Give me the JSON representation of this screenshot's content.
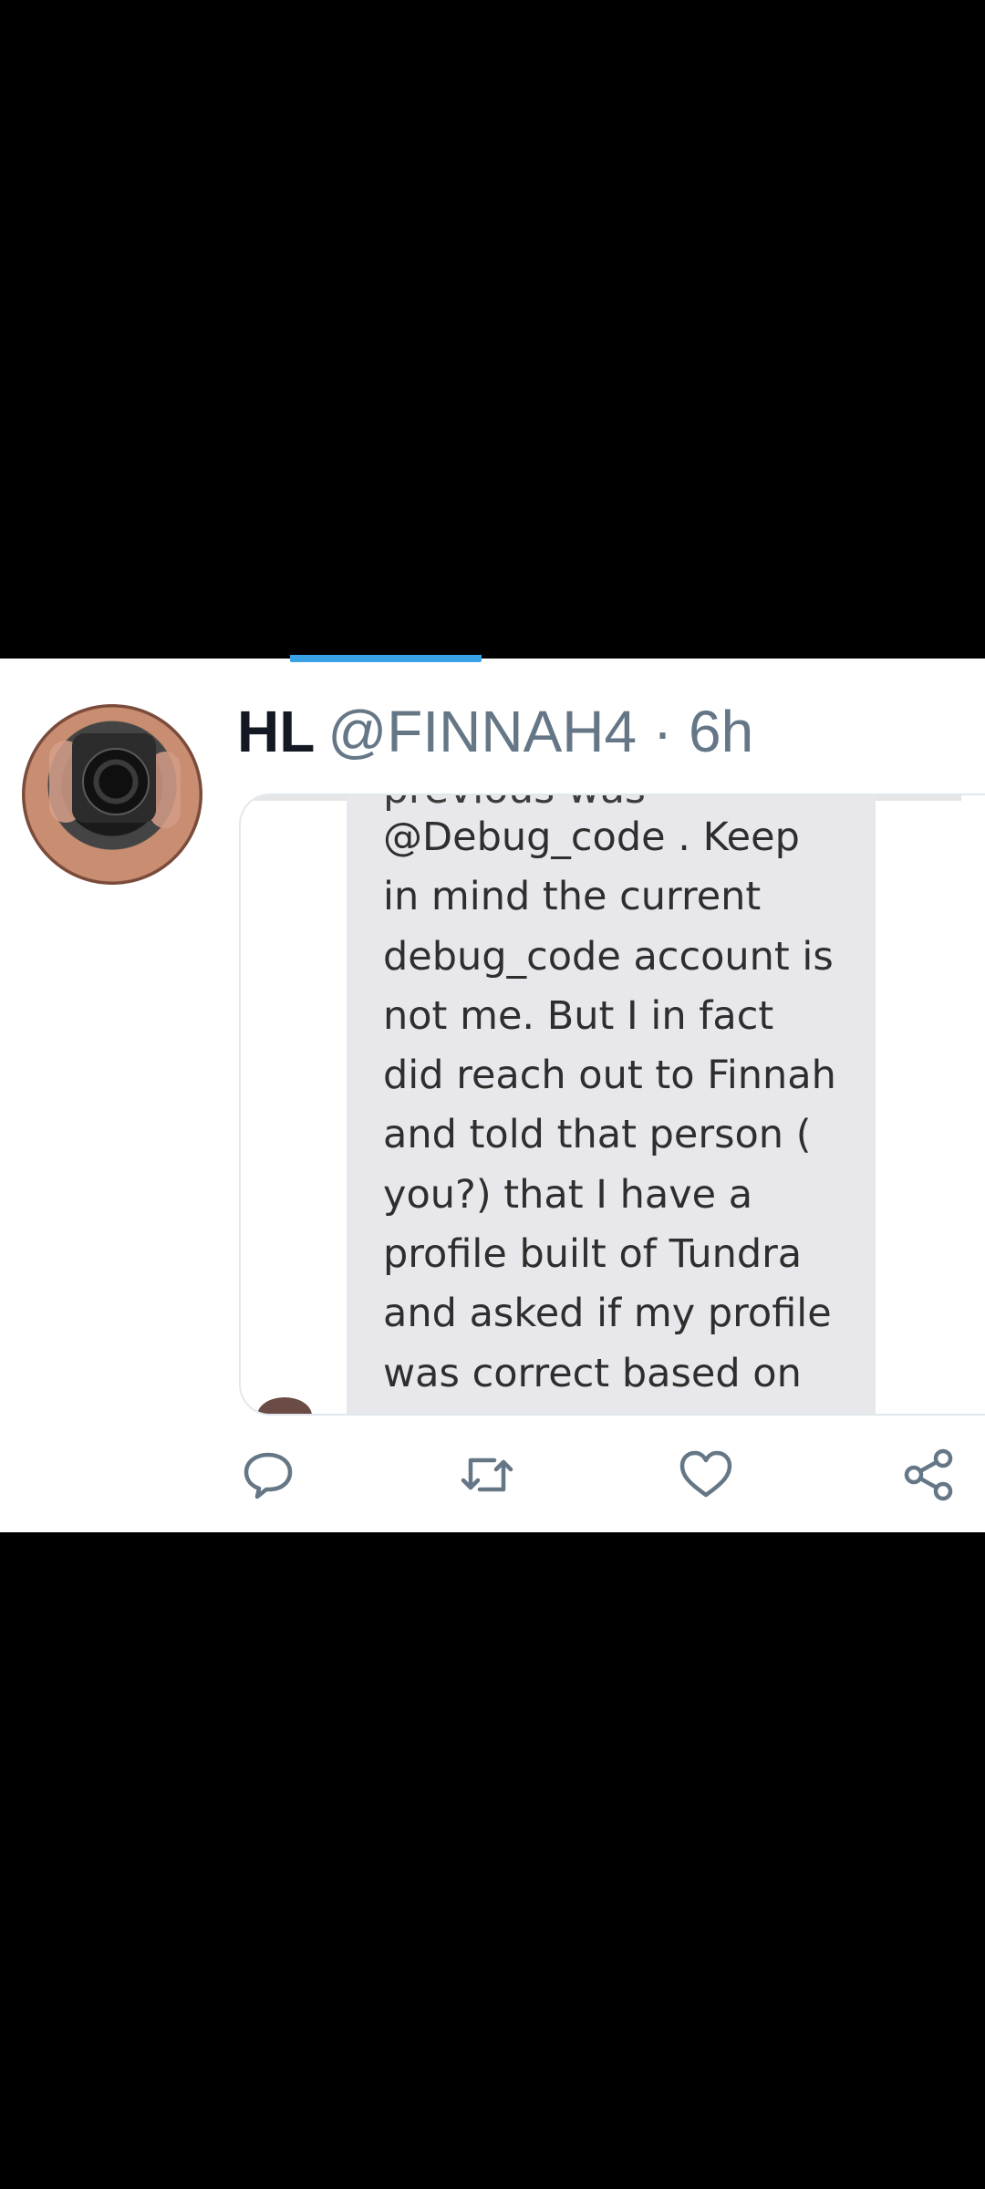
{
  "tweet": {
    "display_name": "HL",
    "handle_time": "@FINNAH4 · 6h",
    "media": {
      "cut_off_line": "previous was",
      "lines": [
        "@Debug_code . Keep",
        "in mind the current",
        "debug_code account is",
        "not me. But I in fact",
        "did reach out to Finnah",
        "and told that person (",
        "you?) that I have a",
        "profile built of Tundra",
        "and asked if my profile",
        "was correct based on"
      ]
    },
    "actions": {
      "reply_icon": "reply-icon",
      "retweet_icon": "retweet-icon",
      "like_icon": "like-icon",
      "share_icon": "share-icon",
      "icon_color": "#657786"
    }
  }
}
